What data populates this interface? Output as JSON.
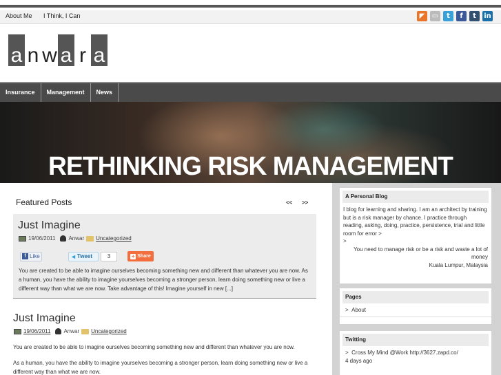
{
  "topnav": [
    "About Me",
    "I Think, I Can"
  ],
  "social_icons": [
    {
      "name": "rss-icon",
      "glyph": "◤",
      "color": "#e8752a"
    },
    {
      "name": "print-icon",
      "glyph": "▭",
      "color": "#bbbbbb"
    },
    {
      "name": "twitter-icon",
      "glyph": "t",
      "color": "#3aa0d8"
    },
    {
      "name": "facebook-icon",
      "glyph": "f",
      "color": "#3b5998"
    },
    {
      "name": "tumblr-icon",
      "glyph": "t",
      "color": "#33506e"
    },
    {
      "name": "linkedin-icon",
      "glyph": "in",
      "color": "#1b6fa8"
    }
  ],
  "logo": {
    "letters": [
      "a",
      "n",
      "w",
      "a",
      "r",
      "a"
    ]
  },
  "mainnav": [
    "Insurance",
    "Management",
    "News"
  ],
  "banner": {
    "title": "RETHINKING RISK MANAGEMENT"
  },
  "featured": {
    "heading": "Featured Posts",
    "prev": "<<",
    "next": ">>",
    "post": {
      "title": "Just Imagine",
      "date": "19/06/2011",
      "author": "Anwar",
      "category": "Uncategorized",
      "like_label": "Like",
      "tweet_label": "Tweet",
      "tweet_count": "3",
      "share_label": "Share",
      "excerpt": "You are created to be able to imagine ourselves becoming something new and different than whatever you are now. As a human, you have the ability to imagine yourselves becoming a stronger person, learn doing something new or live a different way than what we are now. Take advantage of this! Imagine yourself in new [...]"
    }
  },
  "post": {
    "title": "Just Imagine",
    "date": "19/06/2011",
    "author": "Anwar",
    "category": "Uncategorized",
    "para1": "You are created to be able to imagine ourselves becoming something new and different than whatever you are now.",
    "para2": "As a human, you have the ability to imagine yourselves becoming a stronger person, learn doing something new or live a different way than what we are now."
  },
  "sidebar": {
    "blog": {
      "title": "A Personal Blog",
      "text": "I blog for learning and sharing. I am an architect by training but is a risk manager by chance. I practice through reading, asking, doing, practice, persistence, trial and little room for error >",
      "gt": ">",
      "quote": "You need to manage risk or be a risk and waste a lot of money",
      "location": "Kuala Lumpur, Malaysia"
    },
    "pages": {
      "title": "Pages",
      "items": [
        "About"
      ]
    },
    "twitting": {
      "title": "Twitting",
      "tweet": "Cross My Mind @Work http://3627.zapd.co/",
      "time": "4 days ago"
    }
  }
}
